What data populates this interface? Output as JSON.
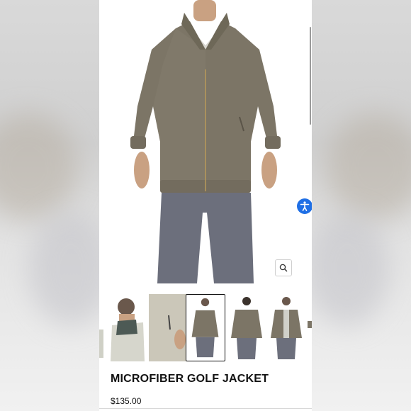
{
  "product": {
    "title": "MICROFIBER GOLF JACKET",
    "price": "$135.00"
  },
  "gallery": {
    "thumbnail_count": 5,
    "active_index": 2,
    "zoom_icon": "magnifier-icon"
  },
  "accessibility": {
    "icon": "accessibility-person-icon",
    "color": "#1f6fe5"
  },
  "colors": {
    "jacket": "#7c7566",
    "pants": "#6c6f7c",
    "skin": "#c9a182",
    "text": "#111111"
  }
}
